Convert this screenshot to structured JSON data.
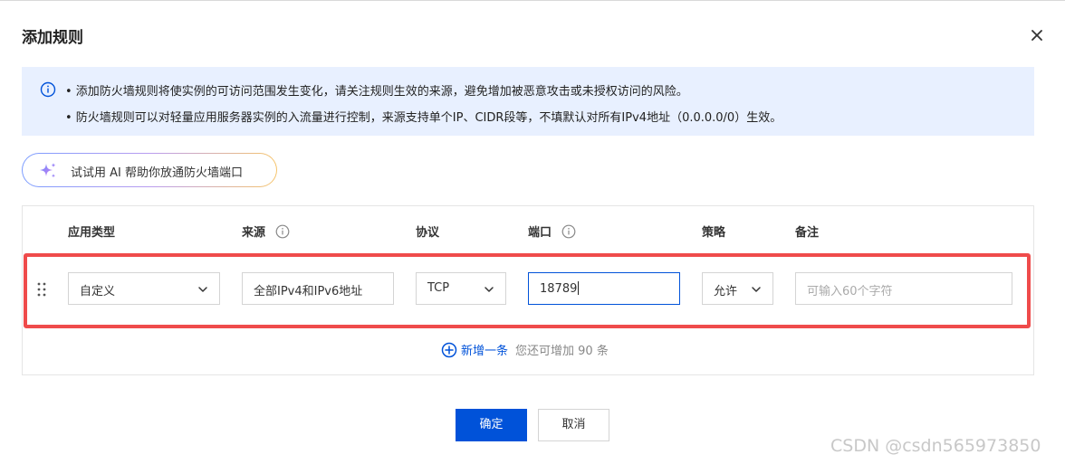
{
  "dialog": {
    "title": "添加规则"
  },
  "notice": {
    "lines": [
      "• 添加防火墙规则将使实例的可访问范围发生变化，请关注规则生效的来源，避免增加被恶意攻击或未授权访问的风险。",
      "• 防火墙规则可以对轻量应用服务器实例的入流量进行控制，来源支持单个IP、CIDR段等，不填默认对所有IPv4地址（0.0.0.0/0）生效。"
    ]
  },
  "ai_button": {
    "label": "试试用 AI 帮助你放通防火墙端口"
  },
  "table": {
    "headers": {
      "app_type": "应用类型",
      "source": "来源",
      "protocol": "协议",
      "port": "端口",
      "policy": "策略",
      "remark": "备注"
    },
    "row": {
      "app_type": "自定义",
      "source": "全部IPv4和IPv6地址",
      "protocol": "TCP",
      "port": "18789",
      "policy": "允许",
      "remark_placeholder": "可输入60个字符"
    }
  },
  "add_row": {
    "label": "新增一条",
    "remaining": "您还可增加 90 条"
  },
  "footer": {
    "confirm": "确定",
    "cancel": "取消"
  },
  "watermark": "CSDN @csdn565973850",
  "icons": {
    "close": "close-icon",
    "info": "info-icon",
    "sparkle": "sparkle-icon",
    "help": "help-circle-icon",
    "drag": "drag-handle-icon",
    "chevron": "chevron-down-icon",
    "add": "plus-circle-icon"
  },
  "colors": {
    "primary": "#0052d9",
    "notice_bg": "#e8f0ff",
    "highlight_frame": "#ef4b4b"
  }
}
